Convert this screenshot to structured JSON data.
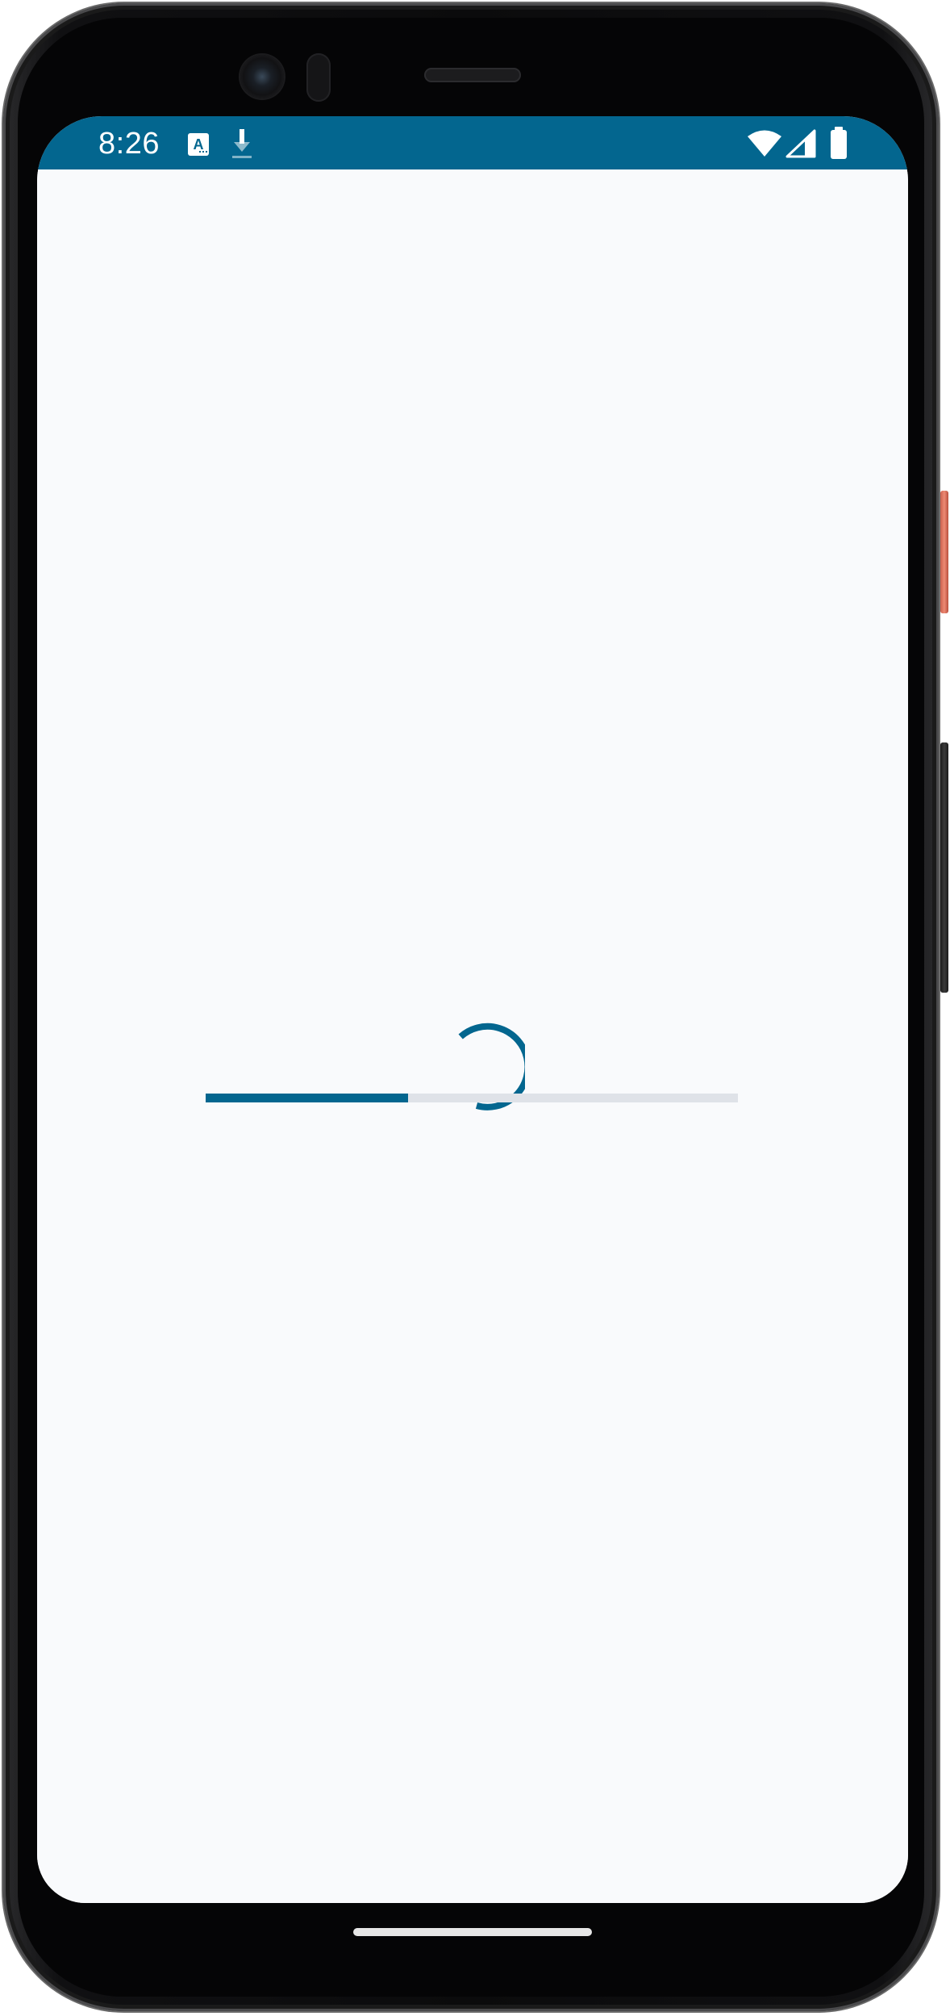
{
  "status_bar": {
    "time": "8:26",
    "background_color": "#03668f",
    "notification_icons": [
      "accessibility-app-icon",
      "download-icon"
    ],
    "system_icons": [
      "wifi-icon",
      "cellular-signal-icon",
      "battery-icon"
    ]
  },
  "loading": {
    "spinner_icon": "loading-spinner-icon",
    "progress_fraction": 0.38,
    "accent_color": "#03668f",
    "track_color": "#dfe2e8"
  },
  "screen": {
    "background_color": "#f9fafc"
  },
  "navigation": {
    "handle": "gesture-handle"
  }
}
